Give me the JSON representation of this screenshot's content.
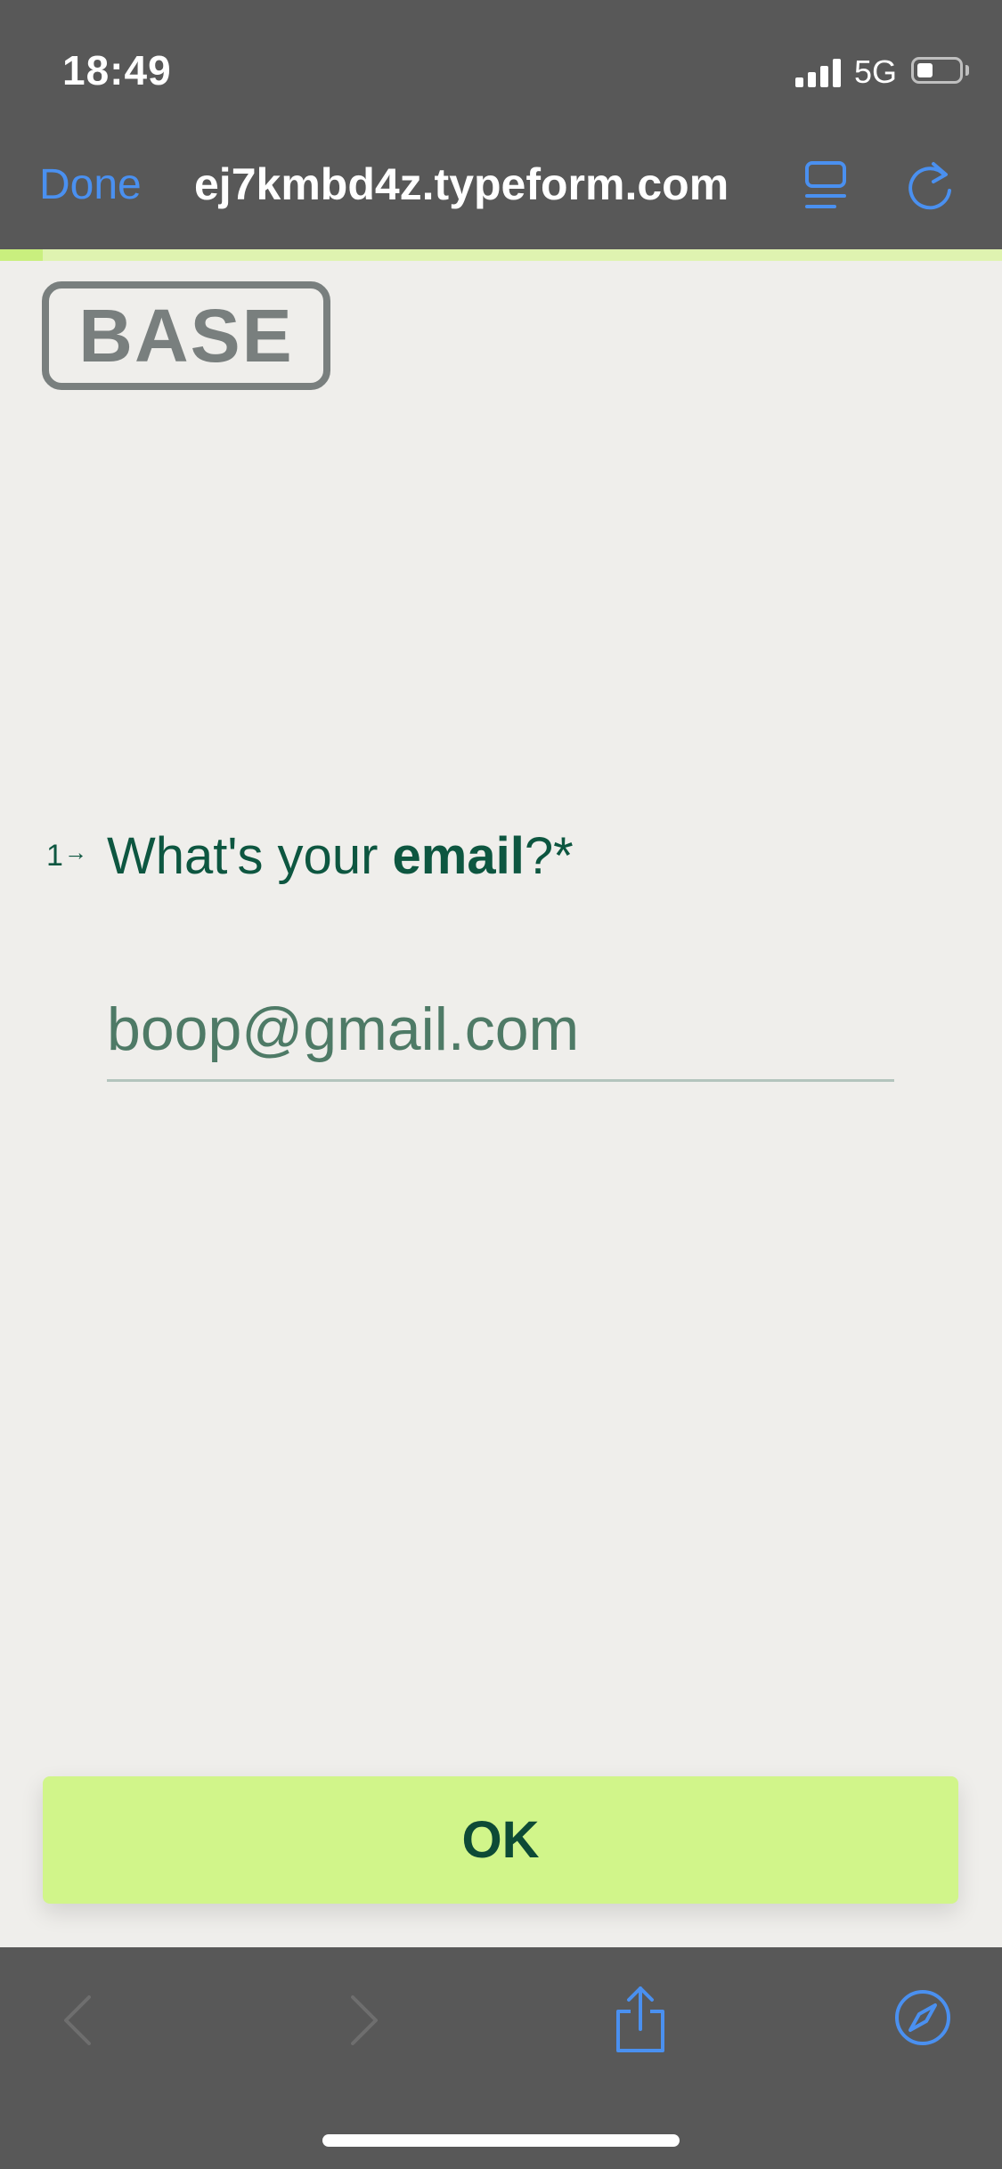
{
  "status_bar": {
    "time": "18:49",
    "network": "5G",
    "signal_icon": "cellular-signal-icon",
    "battery_icon": "battery-icon",
    "battery_level": 0.3
  },
  "browser": {
    "done_label": "Done",
    "url": "ej7kmbd4z.typeform.com",
    "reader_icon": "reader-mode-icon",
    "reload_icon": "reload-icon",
    "accent_color": "#4a90f0"
  },
  "form": {
    "progress": 0.04,
    "logo_alt": "BASE",
    "question_number": "1",
    "question_prefix": "What's your ",
    "question_bold": "email",
    "question_suffix": "?*",
    "email_value": "boop@gmail.com",
    "ok_label": "OK",
    "brand_color": "#0d5640",
    "button_color": "#d1f58a"
  },
  "toolbar": {
    "icons": [
      "back-icon",
      "forward-icon",
      "share-icon",
      "compass-icon"
    ]
  }
}
